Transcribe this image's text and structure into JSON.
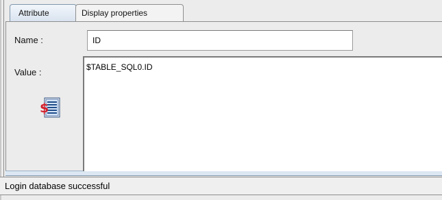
{
  "tabs": {
    "attribute": "Attribute",
    "display": "Display properties"
  },
  "form": {
    "name_label": "Name :",
    "name_value": "ID",
    "value_label": "Value :",
    "value_text": "$TABLE_SQL0.ID"
  },
  "icons": {
    "expression_button": "sql-expression-icon"
  },
  "status": {
    "text": "Login database successful"
  },
  "colors": {
    "active_tab_top": "#f2f6fb",
    "active_tab_bottom": "#d8e3ef",
    "icon_accent": "#d21f2b"
  }
}
